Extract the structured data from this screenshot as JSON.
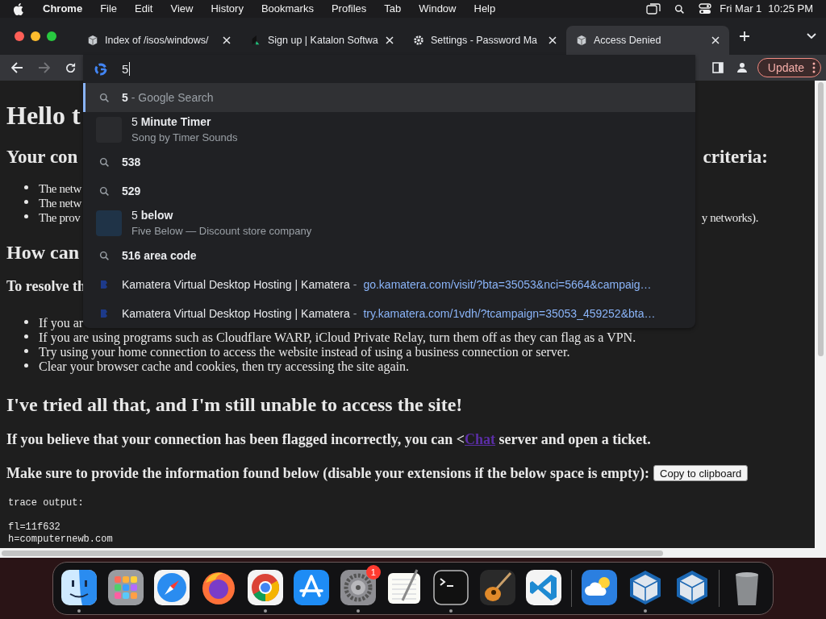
{
  "menu_bar": {
    "app": "Chrome",
    "items": [
      "File",
      "Edit",
      "View",
      "History",
      "Bookmarks",
      "Profiles",
      "Tab",
      "Window",
      "Help"
    ],
    "date": "Fri Mar 1",
    "time": "10:25 PM"
  },
  "tabs": [
    {
      "title": "Index of /isos/windows/",
      "kind": "cube",
      "selected": false
    },
    {
      "title": "Sign up | Katalon Softwa",
      "kind": "logo",
      "selected": false
    },
    {
      "title": "Settings - Password Ma",
      "kind": "gear",
      "selected": false
    },
    {
      "title": "Access Denied",
      "kind": "cube",
      "selected": true
    }
  ],
  "toolbar": {
    "forward_disabled": true,
    "update_button": "Update"
  },
  "omnibox": {
    "value": "5",
    "suggestions": [
      {
        "kind": "search",
        "text": "5",
        "suffix": " - Google Search",
        "selected": true
      },
      {
        "kind": "entity",
        "title": "5 **Minute Timer**",
        "subtitle": "Song by Timer Sounds",
        "color": "#2a2b2e",
        "selected": false
      },
      {
        "kind": "search",
        "text": "538",
        "selected": false
      },
      {
        "kind": "search",
        "text": "529",
        "selected": false
      },
      {
        "kind": "entity",
        "title": "5 **below**",
        "subtitle": "Five Below — Discount store company",
        "color": "#1f3347",
        "selected": false
      },
      {
        "kind": "search",
        "text": "516 area code",
        "selected": false
      },
      {
        "kind": "url",
        "title": "Kamatera Virtual Desktop Hosting | Kamatera",
        "separator": "-",
        "url": "go.kamatera.com/visit/?bta=35053&nci=5664&campaig…",
        "selected": false
      },
      {
        "kind": "url",
        "title": "Kamatera Virtual Desktop Hosting | Kamatera",
        "separator": "-",
        "url": "try.kamatera.com/1vdh/?tcampaign=35053_459252&bta…",
        "selected": false
      }
    ]
  },
  "page": {
    "title": "Hello t",
    "criteria_heading": {
      "left": "Your con",
      "right": "criteria:"
    },
    "criteria": [
      {
        "left": "The netw"
      },
      {
        "left": "The netw"
      },
      {
        "left": "The prov",
        "right": "y networks)."
      }
    ],
    "how_heading": "How can",
    "resolve_intro": "To resolve th",
    "steps": [
      {
        "text": "If you ar"
      },
      {
        "text": "If you are using programs such as Cloudflare WARP, iCloud Private Relay, turn them off as they can flag as a VPN."
      },
      {
        "text": "Try using your home connection to access the website instead of using a business connection or server."
      },
      {
        "text": "Clear your browser cache and cookies, then try accessing the site again."
      }
    ],
    "tried_heading": "I've tried all that, and I'm still unable to access the site!",
    "contact": {
      "before": "If you believe that your connection has been flagged incorrectly, you can <",
      "link": "Chat",
      "after": " server and open a ticket."
    },
    "provide": "Make sure to provide the information found below (disable your extensions if the below space is empty):",
    "copy_button": "Copy to clipboard",
    "trace_title": "trace output:",
    "trace_lines": [
      "fl=11f632",
      "h=computernewb.com"
    ]
  },
  "dock": [
    {
      "kind": "finder",
      "running": true
    },
    {
      "kind": "launchpad",
      "running": false
    },
    {
      "kind": "safari",
      "running": false
    },
    {
      "kind": "firefox",
      "running": false
    },
    {
      "kind": "chrome",
      "running": true
    },
    {
      "kind": "appstore",
      "running": false
    },
    {
      "kind": "settings",
      "running": true,
      "badge": "1"
    },
    {
      "kind": "textedit",
      "running": false
    },
    {
      "kind": "terminal",
      "running": true
    },
    {
      "kind": "garageband",
      "running": false
    },
    {
      "kind": "vscode",
      "running": false
    },
    {
      "kind": "separator"
    },
    {
      "kind": "weather",
      "running": false
    },
    {
      "kind": "virtualbox",
      "running": true
    },
    {
      "kind": "virtualbox",
      "running": false
    },
    {
      "kind": "separator"
    },
    {
      "kind": "trash",
      "running": false
    }
  ]
}
